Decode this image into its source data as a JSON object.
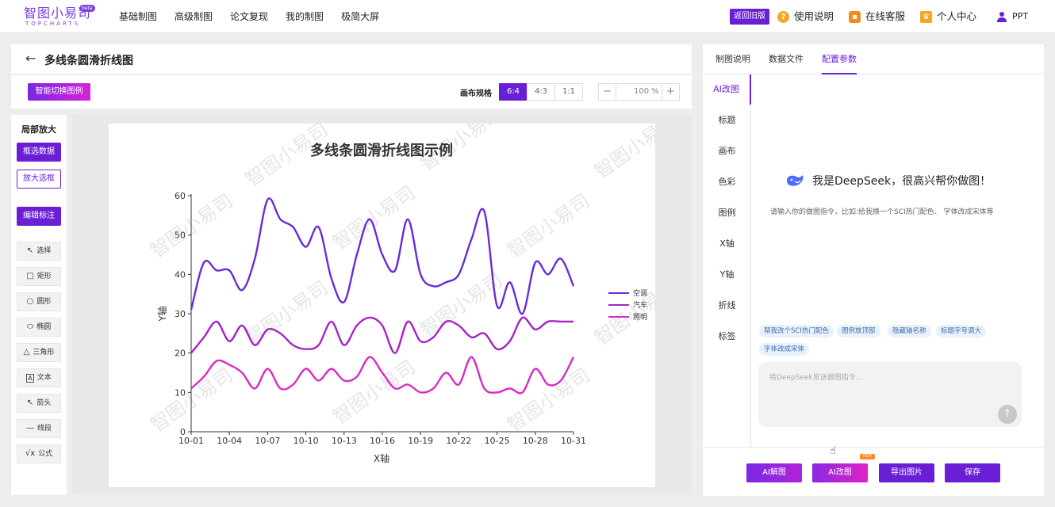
{
  "logo": {
    "main": "智图小易司",
    "sub": "TOPCHARTS",
    "badge": "beta"
  },
  "nav": [
    "基础制图",
    "高级制图",
    "论文复现",
    "我的制图",
    "极简大屏"
  ],
  "top_right": {
    "old_version": "返回旧版",
    "help": "使用说明",
    "service": "在线客服",
    "center": "个人中心",
    "user": "PPT"
  },
  "page": {
    "back_icon": "arrow-left-icon",
    "title": "多线条圆滑折线图"
  },
  "toolbar": {
    "switch_label": "智能切换图例",
    "ratio_label": "画布规格",
    "ratios": [
      "6:4",
      "4:3",
      "1:1"
    ],
    "active_ratio": "6:4",
    "zoom_minus": "−",
    "zoom_value": "100",
    "zoom_unit": "%",
    "zoom_plus": "+"
  },
  "left_tools": {
    "title": "局部放大",
    "select_data": "框选数据",
    "zoom_box": "放大选框",
    "edit_label": "编辑标注",
    "tools": [
      {
        "icon": "↖",
        "label": "选择"
      },
      {
        "icon": "□",
        "label": "矩形"
      },
      {
        "icon": "○",
        "label": "圆形"
      },
      {
        "icon": "⬭",
        "label": "椭圆"
      },
      {
        "icon": "△",
        "label": "三角形"
      },
      {
        "icon": "A",
        "label": "文本"
      },
      {
        "icon": "↖",
        "label": "箭头"
      },
      {
        "icon": "—",
        "label": "线段"
      },
      {
        "icon": "√x",
        "label": "公式"
      }
    ]
  },
  "watermark": "智图小易司",
  "chart_data": {
    "type": "line",
    "title": "多线条圆滑折线图示例",
    "xlabel": "X轴",
    "ylabel": "Y轴",
    "x": [
      "10-01",
      "10-02",
      "10-03",
      "10-04",
      "10-05",
      "10-06",
      "10-07",
      "10-08",
      "10-09",
      "10-10",
      "10-11",
      "10-12",
      "10-13",
      "10-14",
      "10-15",
      "10-16",
      "10-17",
      "10-18",
      "10-19",
      "10-20",
      "10-21",
      "10-22",
      "10-23",
      "10-24",
      "10-25",
      "10-26",
      "10-27",
      "10-28",
      "10-29",
      "10-30",
      "10-31"
    ],
    "x_ticks": [
      "10-01",
      "10-04",
      "10-07",
      "10-10",
      "10-13",
      "10-16",
      "10-19",
      "10-22",
      "10-25",
      "10-28",
      "10-31"
    ],
    "ylim": [
      0,
      60
    ],
    "y_ticks": [
      0,
      10,
      20,
      30,
      40,
      50,
      60
    ],
    "smooth": true,
    "grid": false,
    "legend_position": "right",
    "series": [
      {
        "name": "空调",
        "color": "#6a2bd8",
        "values": [
          31,
          43,
          41,
          41,
          36,
          44,
          59,
          54,
          52,
          47,
          52,
          39,
          33,
          45,
          54,
          45,
          41,
          54,
          40,
          37,
          38,
          40,
          49,
          56,
          32,
          38,
          30,
          43,
          40,
          44,
          37
        ]
      },
      {
        "name": "汽车",
        "color": "#a423c9",
        "values": [
          20,
          24,
          28,
          23,
          27,
          22,
          26,
          25,
          22,
          21,
          22,
          28,
          22,
          27,
          29,
          27,
          20,
          28,
          23,
          24,
          28,
          27,
          24,
          25,
          21,
          23,
          29,
          26,
          28,
          28,
          28
        ]
      },
      {
        "name": "照明",
        "color": "#d92bc3",
        "values": [
          11,
          14,
          18,
          17,
          15,
          11,
          16,
          11,
          12,
          16,
          13,
          16,
          13,
          14,
          19,
          15,
          11,
          12,
          10,
          11,
          15,
          12,
          19,
          11,
          10,
          11,
          10,
          16,
          12,
          13,
          19
        ]
      }
    ]
  },
  "right_panel": {
    "tabs": [
      "制图说明",
      "数据文件",
      "配置参数"
    ],
    "active_tab": "配置参数",
    "menu": [
      "AI改图",
      "标题",
      "画布",
      "色彩",
      "图例",
      "X轴",
      "Y轴",
      "折线",
      "标签"
    ],
    "active_menu": "AI改图",
    "ds_greeting": "我是DeepSeek，很高兴帮你做图！",
    "ds_hint": "请输入你的做图指令，比如:给我换一个SCI热门配色、 字体改成宋体等",
    "suggestions": [
      "帮我改个SCI热门配色",
      "图例放顶部",
      "隐藏轴名称",
      "标题字号调大",
      "字体改成宋体"
    ],
    "input_placeholder": "给DeepSeek发送做图指令...",
    "buttons": [
      "AI解图",
      "AI改图",
      "导出图片",
      "保存"
    ],
    "hot_badge": "HOT"
  }
}
